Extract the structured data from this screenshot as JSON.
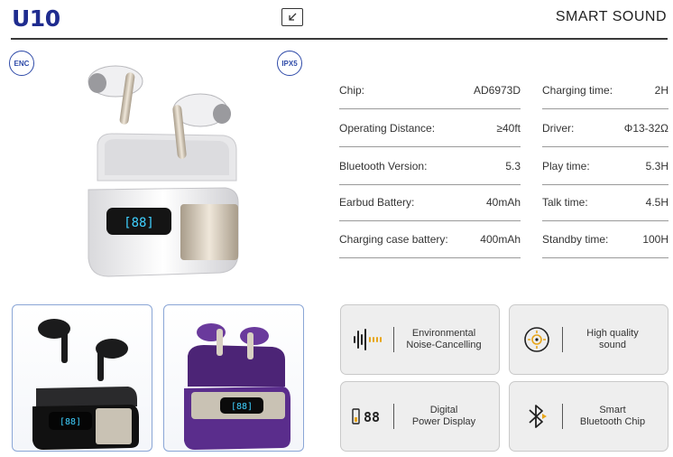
{
  "header": {
    "brand": "U10",
    "title": "SMART SOUND",
    "expand_icon": "arrow-down-left-icon"
  },
  "badges": {
    "enc": "ENC",
    "ipx": "IPX5"
  },
  "specs_left": [
    {
      "label": "Chip:",
      "value": "AD6973D"
    },
    {
      "label": "Operating Distance:",
      "value": "≥40ft"
    },
    {
      "label": "Bluetooth Version:",
      "value": "5.3"
    },
    {
      "label": "Earbud Battery:",
      "value": "40mAh"
    },
    {
      "label": "Charging case battery:",
      "value": "400mAh"
    }
  ],
  "specs_right": [
    {
      "label": "Charging time:",
      "value": "2H"
    },
    {
      "label": "Driver:",
      "value": "Φ13-32Ω"
    },
    {
      "label": "Play time:",
      "value": "5.3H"
    },
    {
      "label": "Talk time:",
      "value": "4.5H"
    },
    {
      "label": "Standby time:",
      "value": "100H"
    }
  ],
  "features": [
    {
      "text": "Environmental\nNoise-Cancelling",
      "icon": "sound-wave-icon"
    },
    {
      "text": "High quality\nsound",
      "icon": "speaker-icon"
    },
    {
      "text": "Digital\nPower Display",
      "icon": "battery-display-icon"
    },
    {
      "text": "Smart\nBluetooth Chip",
      "icon": "bluetooth-icon"
    }
  ],
  "colors": {
    "brand": "#1f2c8f",
    "badge": "#2e4aa8",
    "thumb_border": "#8aa6d6",
    "led": "#3fd0ff",
    "purple": "#5a2d8c"
  }
}
